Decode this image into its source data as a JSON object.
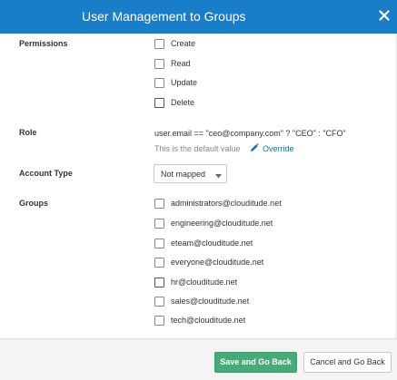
{
  "dialog": {
    "title": "User Management to Groups",
    "close_icon": "close-icon"
  },
  "permissions": {
    "label": "Permissions",
    "options": [
      {
        "label": "Create",
        "checked": false
      },
      {
        "label": "Read",
        "checked": false
      },
      {
        "label": "Update",
        "checked": false
      },
      {
        "label": "Delete",
        "checked": false
      }
    ]
  },
  "role": {
    "label": "Role",
    "expression": "user.email == \"ceo@company.com\" ? \"CEO\" : \"CFO\"",
    "default_note": "This is the default value",
    "override_label": "Override",
    "override_icon": "pencil-icon"
  },
  "account_type": {
    "label": "Account Type",
    "selected": "Not mapped",
    "caret_icon": "caret-down-icon"
  },
  "groups": {
    "label": "Groups",
    "items": [
      {
        "label": "administrators@clouditude.net",
        "checked": false
      },
      {
        "label": "engineering@clouditude.net",
        "checked": false
      },
      {
        "label": "eteam@clouditude.net",
        "checked": false
      },
      {
        "label": "everyone@clouditude.net",
        "checked": false
      },
      {
        "label": "hr@clouditude.net",
        "checked": false
      },
      {
        "label": "sales@clouditude.net",
        "checked": false
      },
      {
        "label": "tech@clouditude.net",
        "checked": false
      }
    ]
  },
  "footer": {
    "save_label": "Save and Go Back",
    "cancel_label": "Cancel and Go Back"
  },
  "colors": {
    "header": "#1a7dc8",
    "save_button": "#4aa97a",
    "link": "#1a6fb5"
  }
}
